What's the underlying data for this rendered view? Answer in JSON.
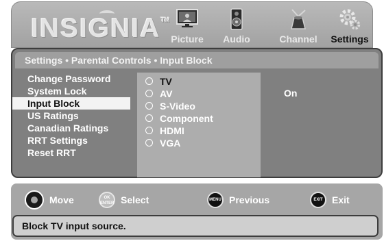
{
  "brand": {
    "logo": "INSIGNIA",
    "trademark": "TM"
  },
  "tabs": [
    {
      "label": "Picture",
      "icon": "tv-monitor-icon"
    },
    {
      "label": "Audio",
      "icon": "speaker-icon"
    },
    {
      "label": "Channel",
      "icon": "antenna-icon"
    },
    {
      "label": "Settings",
      "icon": "gears-icon",
      "active": true
    }
  ],
  "breadcrumb": "Settings • Parental Controls • Input Block",
  "menu": {
    "items": [
      "Change Password",
      "System Lock",
      "Input Block",
      "US Ratings",
      "Canadian Ratings",
      "RRT Settings",
      "Reset RRT"
    ],
    "selected": "Input Block"
  },
  "input_sources": {
    "options": [
      "TV",
      "AV",
      "S-Video",
      "Component",
      "HDMI",
      "VGA"
    ],
    "highlighted": "TV"
  },
  "value": "On",
  "nav_hints": [
    {
      "icon": "dpad-icon",
      "label": "Move"
    },
    {
      "icon": "ok-enter-button-icon",
      "icon_text": [
        "OK",
        "ENTER"
      ],
      "label": "Select"
    },
    {
      "icon": "menu-button-icon",
      "icon_text": "MENU",
      "label": "Previous"
    },
    {
      "icon": "exit-button-icon",
      "icon_text": "EXIT",
      "label": "Exit"
    }
  ],
  "help_text": "Block TV input source.",
  "colors": {
    "header_bg": "#a8a8a8",
    "panel_bg": "#808080",
    "submenu_bg": "#adadad",
    "selected_bg": "#f3f3f3",
    "help_bg": "#cfcfcf"
  }
}
